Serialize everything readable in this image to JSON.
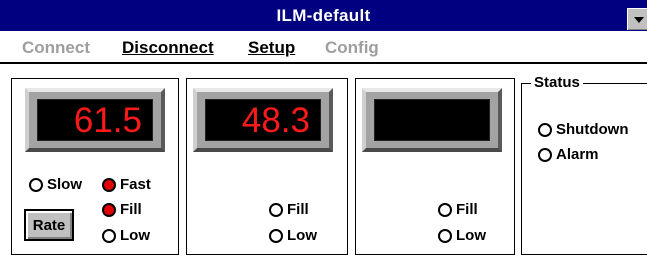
{
  "window": {
    "title": "ILM-default"
  },
  "menu": {
    "connect": "Connect",
    "disconnect": "Disconnect",
    "setup": "Setup",
    "config": "Config"
  },
  "channels": [
    {
      "display_value": "61.5",
      "rate": {
        "slow": "Slow",
        "fast": "Fast",
        "selected": "fast"
      },
      "rate_button": "Rate",
      "level": {
        "fill": "Fill",
        "low": "Low",
        "fill_on": true,
        "low_on": false
      }
    },
    {
      "display_value": "48.3",
      "level": {
        "fill": "Fill",
        "low": "Low",
        "fill_on": false,
        "low_on": false
      }
    },
    {
      "display_value": "",
      "level": {
        "fill": "Fill",
        "low": "Low",
        "fill_on": false,
        "low_on": false
      }
    }
  ],
  "status": {
    "label": "Status",
    "shutdown": "Shutdown",
    "alarm": "Alarm"
  },
  "colors": {
    "titlebar": "#000080",
    "led_digits": "#ff1a1a",
    "indicator_on": "#e00000",
    "disabled_text": "#9e9e9e"
  }
}
